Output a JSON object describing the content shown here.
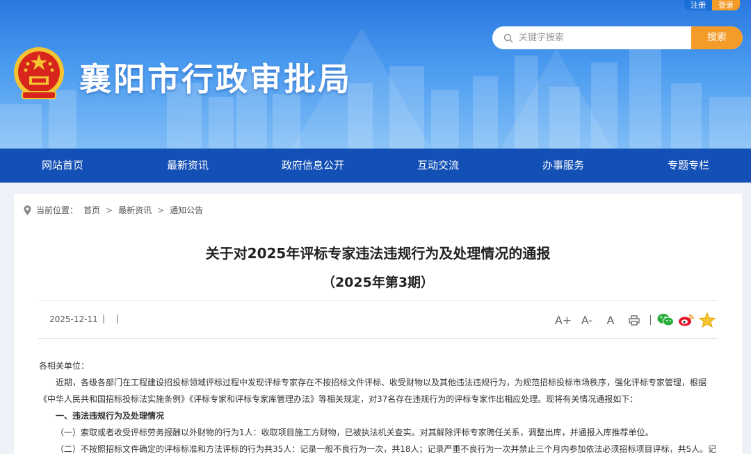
{
  "header": {
    "site_title": "襄阳市行政审批局",
    "auth": {
      "register": "注册",
      "login": "登录"
    },
    "search": {
      "placeholder": "关键字搜索",
      "button": "搜索"
    }
  },
  "nav": {
    "items": [
      {
        "label": "网站首页"
      },
      {
        "label": "最新资讯"
      },
      {
        "label": "政府信息公开"
      },
      {
        "label": "互动交流"
      },
      {
        "label": "办事服务"
      },
      {
        "label": "专题专栏"
      }
    ]
  },
  "breadcrumb": {
    "prefix": "当前位置：",
    "items": [
      "首页",
      "最新资讯",
      "通知公告"
    ],
    "separator": ">"
  },
  "article": {
    "title": "关于对2025年评标专家违法违规行为及处理情况的通报",
    "subtitle": "（2025年第3期）",
    "date": "2025-12-11",
    "divider": "|",
    "font_tools": {
      "enlarge": "A+",
      "shrink": "A-",
      "reset": "A"
    },
    "paragraphs": [
      "各相关单位：",
      "近期，各级各部门在工程建设招投标领域评标过程中发现评标专家存在不按招标文件评标、收受财物以及其他违法违规行为，为规范招标投标市场秩序，强化评标专家管理，根据",
      "《中华人民共和国招标投标法实施条例》《评标专家和评标专家库管理办法》等相关规定，对37名存在违规行为的评标专家作出相应处理。现将有关情况通报如下：",
      "一、违法违规行为及处理情况",
      "（一）索取或者收受评标劳务报酬以外财物的行为1人：收取项目施工方财物，已被执法机关查实。对其解除评标专家聘任关系，调整出库，并通报入库推荐单位。",
      "（二）不按照招标文件确定的评标标准和方法评标的行为共35人：记录一般不良行为一次，共18人；记录严重不良行为一次并禁止三个月内参加依法必须招标项目评标，共5人。记"
    ]
  },
  "colors": {
    "nav_bg": "#1350b6",
    "accent_orange": "#f49b2a",
    "banner_top": "#2a78e0"
  }
}
